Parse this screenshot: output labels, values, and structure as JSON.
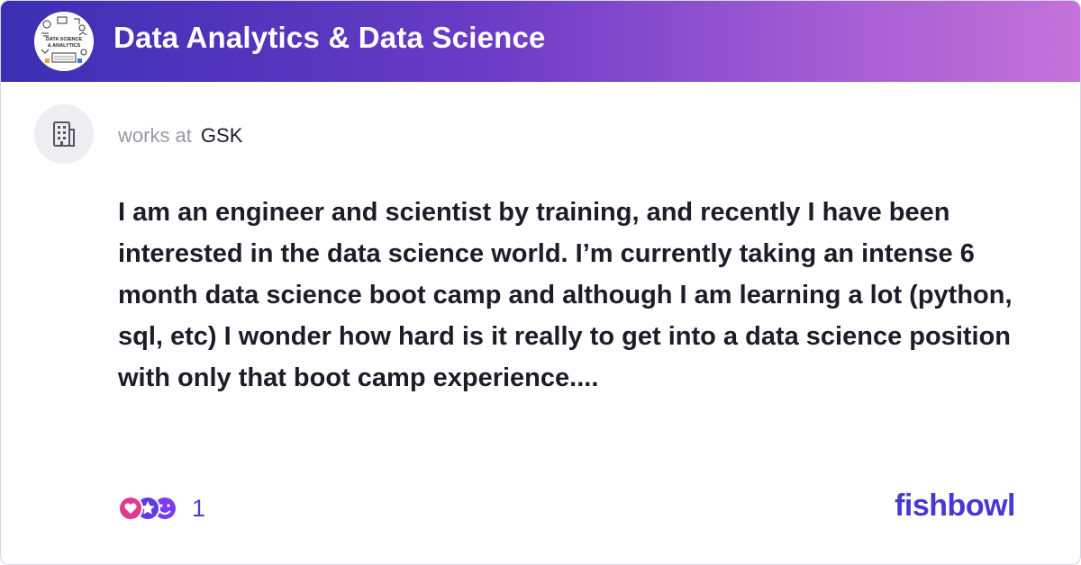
{
  "header": {
    "title": "Data Analytics & Data Science",
    "avatar_text_line1": "DATA SCIENCE",
    "avatar_text_line2": "& ANALYTICS"
  },
  "author": {
    "works_at_label": "works at",
    "company": "GSK",
    "avatar_icon": "building-icon"
  },
  "post": {
    "text": "I am an engineer and scientist by training, and recently I have been interested in the data science world. I’m currently taking an intense 6 month data science boot camp and although I am learning a lot (python, sql, etc) I wonder how hard is it really to get into a data science position with only that boot camp experience...."
  },
  "footer": {
    "reaction_icons": [
      "heart-reaction-icon",
      "star-reaction-icon",
      "smile-reaction-icon"
    ],
    "reaction_count": "1",
    "brand": "fishbowl"
  },
  "colors": {
    "header_gradient_start": "#3a2fb3",
    "header_gradient_end": "#c472d8",
    "brand": "#4737d4",
    "count": "#4a3fcf"
  }
}
